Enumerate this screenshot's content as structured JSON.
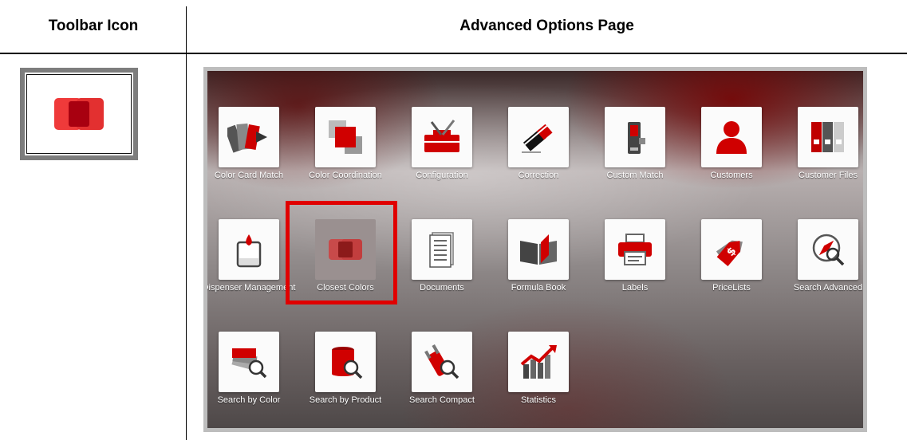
{
  "headers": {
    "toolbar_icon": "Toolbar Icon",
    "advanced_options_page": "Advanced Options Page"
  },
  "toolbar": {
    "icon": "closest-colors-icon"
  },
  "colors": {
    "accent": "#d90000",
    "highlight": "#e00000"
  },
  "tiles": [
    {
      "label": "Color Card Match",
      "icon": "color-card-match-icon"
    },
    {
      "label": "Color Coordination",
      "icon": "color-coordination-icon"
    },
    {
      "label": "Configuration",
      "icon": "configuration-icon"
    },
    {
      "label": "Correction",
      "icon": "correction-icon"
    },
    {
      "label": "Custom Match",
      "icon": "custom-match-icon"
    },
    {
      "label": "Customers",
      "icon": "customers-icon"
    },
    {
      "label": "Customer Files",
      "icon": "customer-files-icon"
    },
    {
      "label": "Dispenser Management",
      "icon": "dispenser-management-icon"
    },
    {
      "label": "Closest Colors",
      "icon": "closest-colors-icon"
    },
    {
      "label": "Documents",
      "icon": "documents-icon"
    },
    {
      "label": "Formula Book",
      "icon": "formula-book-icon"
    },
    {
      "label": "Labels",
      "icon": "labels-icon"
    },
    {
      "label": "PriceLists",
      "icon": "pricelists-icon"
    },
    {
      "label": "Search Advanced",
      "icon": "search-advanced-icon"
    },
    {
      "label": "Search by Color",
      "icon": "search-by-color-icon"
    },
    {
      "label": "Search by Product",
      "icon": "search-by-product-icon"
    },
    {
      "label": "Search Compact",
      "icon": "search-compact-icon"
    },
    {
      "label": "Statistics",
      "icon": "statistics-icon"
    }
  ]
}
